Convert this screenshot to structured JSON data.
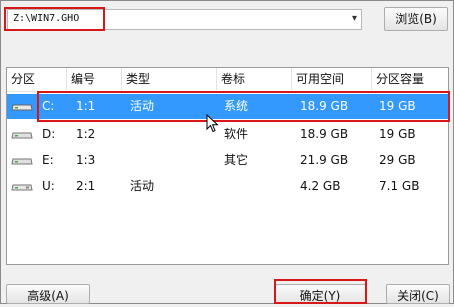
{
  "path": {
    "value": "Z:\\WIN7.GHO",
    "arrow": "▾"
  },
  "buttons": {
    "browse": "浏览(B)",
    "advanced": "高级(A)",
    "ok": "确定(Y)",
    "close": "关闭(C)"
  },
  "table": {
    "headers": [
      "分区",
      "编号",
      "类型",
      "卷标",
      "可用空间",
      "分区容量"
    ],
    "rows": [
      {
        "partition": "C:",
        "number": "1:1",
        "type": "活动",
        "label": "系统",
        "free": "18.9 GB",
        "capacity": "19 GB",
        "selected": true,
        "icon": "hard-drive-icon"
      },
      {
        "partition": "D:",
        "number": "1:2",
        "type": "",
        "label": "软件",
        "free": "18.9 GB",
        "capacity": "19 GB",
        "selected": false,
        "icon": "hard-drive-icon"
      },
      {
        "partition": "E:",
        "number": "1:3",
        "type": "",
        "label": "其它",
        "free": "21.9 GB",
        "capacity": "29 GB",
        "selected": false,
        "icon": "hard-drive-icon"
      },
      {
        "partition": "U:",
        "number": "2:1",
        "type": "活动",
        "label": "",
        "free": "4.2 GB",
        "capacity": "7.1 GB",
        "selected": false,
        "icon": "usb-drive-icon"
      }
    ]
  },
  "colors": {
    "selection": "#3399ff",
    "highlight_box": "#d81818"
  }
}
